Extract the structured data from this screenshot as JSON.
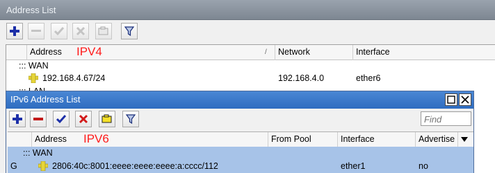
{
  "address_list": {
    "title": "Address List",
    "toolbar": {
      "add_icon": "plus-icon",
      "remove_icon": "minus-icon",
      "enable_icon": "check-icon",
      "disable_icon": "cross-icon",
      "comment_icon": "comment-icon",
      "filter_icon": "filter-icon"
    },
    "columns": [
      "Address",
      "Network",
      "Interface"
    ],
    "sort_indicator": "/",
    "annotation": "IPV4",
    "groups": [
      {
        "label": "::: WAN",
        "rows": [
          {
            "address": "192.168.4.67/24",
            "network": "192.168.4.0",
            "interface": "ether6"
          }
        ]
      },
      {
        "label": "::: LAN",
        "rows": []
      }
    ]
  },
  "ipv6_address_list": {
    "title": "IPv6 Address List",
    "find_placeholder": "Find",
    "columns": [
      "Address",
      "From Pool",
      "Interface",
      "Advertise"
    ],
    "annotation": "IPV6",
    "groups": [
      {
        "label": "::: WAN",
        "rows": [
          {
            "flag": "G",
            "address": "2806:40c:8001:eeee:eeee:eeee:a:cccc/112",
            "from_pool": "",
            "interface": "ether1",
            "advertise": "no"
          }
        ]
      }
    ]
  },
  "colors": {
    "accent_blue": "#2e6cc0",
    "selected_row": "#a7c3e8",
    "annotation_red": "#ff1a1a"
  }
}
